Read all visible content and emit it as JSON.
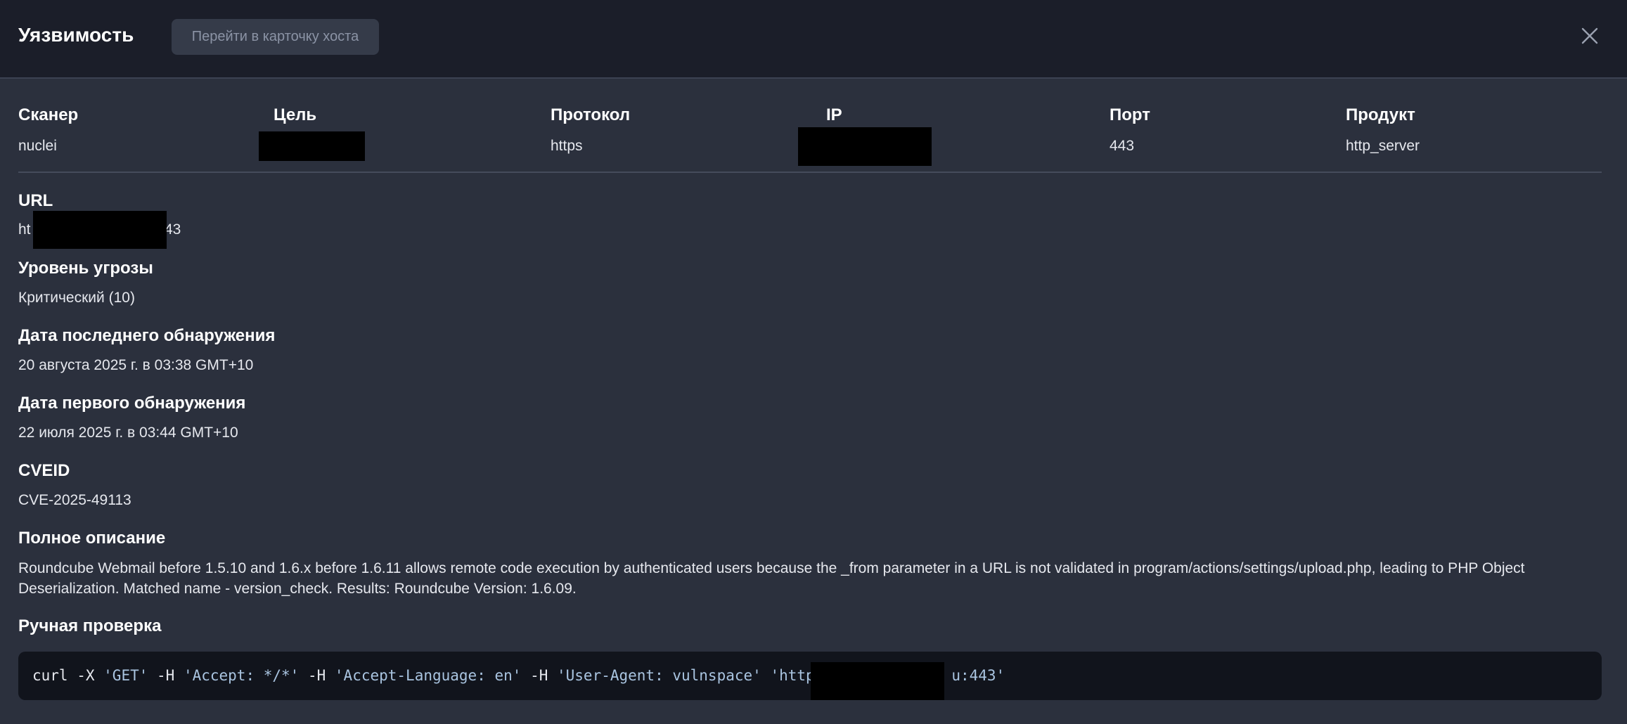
{
  "header": {
    "title": "Уязвимость",
    "host_button_label": "Перейти в карточку хоста",
    "close_icon": "close-icon"
  },
  "summary": {
    "scanner_label": "Сканер",
    "scanner_value": "nuclei",
    "target_label": "Цель",
    "target_value": "",
    "protocol_label": "Протокол",
    "protocol_value": "https",
    "ip_label": "IP",
    "ip_value": "",
    "port_label": "Порт",
    "port_value": "443",
    "product_label": "Продукт",
    "product_value": "http_server"
  },
  "details": {
    "url_label": "URL",
    "url_prefix": "ht",
    "url_suffix": "43",
    "threat_label": "Уровень угрозы",
    "threat_value": "Критический (10)",
    "last_seen_label": "Дата последнего обнаружения",
    "last_seen_value": "20 августа 2025 г. в 03:38 GMT+10",
    "first_seen_label": "Дата первого обнаружения",
    "first_seen_value": "22 июля 2025 г. в 03:44 GMT+10",
    "cveid_label": "CVEID",
    "cveid_value": "CVE-2025-49113",
    "description_label": "Полное описание",
    "description_value": "Roundcube Webmail before 1.5.10 and 1.6.x before 1.6.11 allows remote code execution by authenticated users because the _from parameter in a URL is not validated in program/actions/settings/upload.php, leading to PHP Object Deserialization. Matched name - version_check. Results: Roundcube Version: 1.6.09.",
    "manual_check_label": "Ручная проверка"
  },
  "code": {
    "part1": "curl -X ",
    "str1": "'GET'",
    "part2": " -H ",
    "str2": "'Accept: */*'",
    "part3": " -H ",
    "str3": "'Accept-Language: en'",
    "part4": " -H ",
    "str4": "'User-Agent: vulnspace'",
    "part5": " ",
    "str5_prefix": "'https",
    "str5_suffix": "u:443'"
  },
  "colors": {
    "header_bg": "#1b1e29",
    "panel_bg": "#2b303d",
    "code_bg": "#11141c",
    "string_color": "#a9c4e0"
  }
}
